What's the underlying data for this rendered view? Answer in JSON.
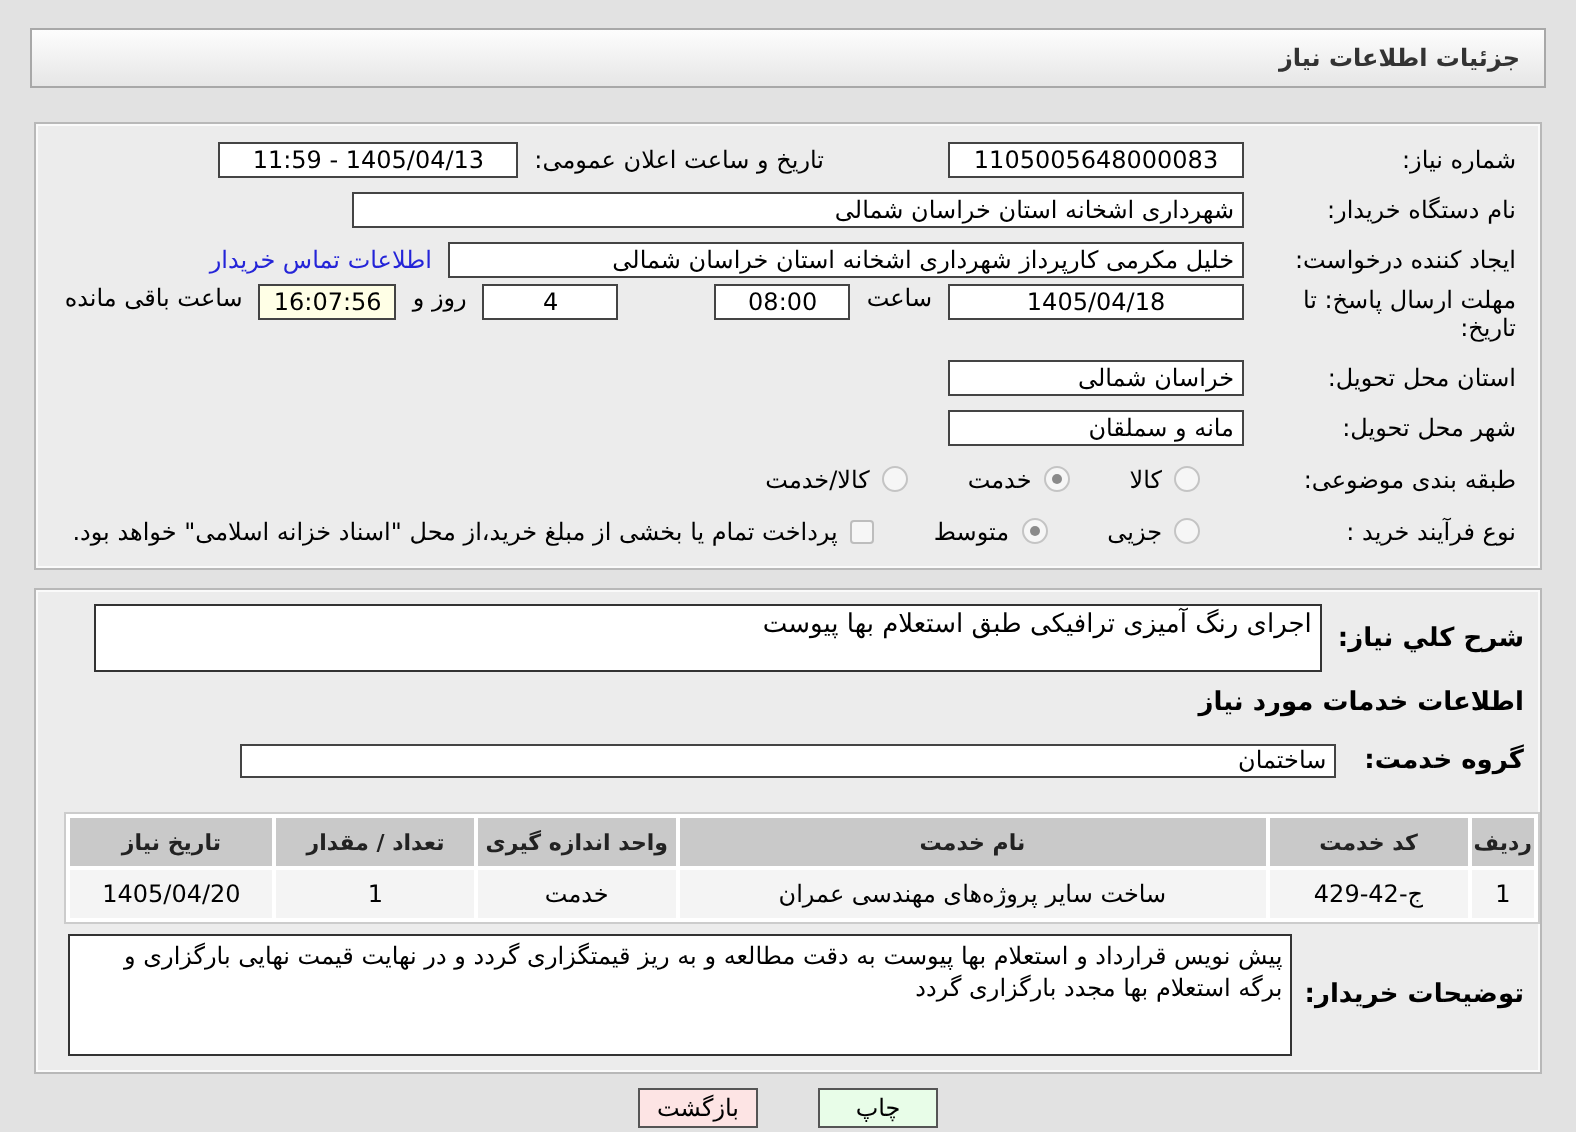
{
  "header": {
    "title": "جزئیات اطلاعات نیاز"
  },
  "need_number": {
    "label": "شماره نیاز:",
    "value": "1105005648000083"
  },
  "announce": {
    "label": "تاریخ و ساعت اعلان عمومی:",
    "value": "1405/04/13 - 11:59"
  },
  "buyer_org": {
    "label": "نام دستگاه خریدار:",
    "value": "شهرداری اشخانه استان خراسان شمالی"
  },
  "requester": {
    "label": "ایجاد کننده درخواست:",
    "value": "خلیل مکرمی کارپرداز شهرداری اشخانه استان خراسان شمالی",
    "link": "اطلاعات تماس خریدار"
  },
  "deadline": {
    "label": "مهلت ارسال پاسخ: تا تاریخ:",
    "date": "1405/04/18",
    "time_label": "ساعت",
    "time": "08:00",
    "days": "4",
    "days_label": "روز و",
    "remaining": "16:07:56",
    "remaining_label": "ساعت باقی مانده"
  },
  "province": {
    "label": "استان محل تحویل:",
    "value": "خراسان شمالی"
  },
  "city": {
    "label": "شهر محل تحویل:",
    "value": "مانه و سملقان"
  },
  "category": {
    "label": "طبقه بندی موضوعی:",
    "options": [
      {
        "label": "کالا",
        "selected": false
      },
      {
        "label": "خدمت",
        "selected": true
      },
      {
        "label": "کالا/خدمت",
        "selected": false
      }
    ]
  },
  "process": {
    "label": "نوع فرآیند خرید :",
    "options": [
      {
        "label": "جزیی",
        "selected": false
      },
      {
        "label": "متوسط",
        "selected": true
      }
    ],
    "payment": {
      "checked": false,
      "text": "پرداخت تمام یا بخشی از مبلغ خرید،از محل \"اسناد خزانه اسلامی\" خواهد بود."
    }
  },
  "summary": {
    "label": "شرح كلي نياز:",
    "value": "اجرای رنگ آمیزی ترافیکی طبق استعلام بها پیوست"
  },
  "services_title": "اطلاعات خدمات مورد نیاز",
  "service_group": {
    "label": "گروه خدمت:",
    "value": "ساختمان"
  },
  "table": {
    "columns": [
      "ردیف",
      "کد خدمت",
      "نام خدمت",
      "واحد اندازه گیری",
      "تعداد / مقدار",
      "تاریخ نیاز"
    ],
    "rows": [
      [
        "1",
        "ج-42-429",
        "ساخت سایر پروژه‌های مهندسی عمران",
        "خدمت",
        "1",
        "1405/04/20"
      ]
    ]
  },
  "buyer_notes": {
    "label": "توضیحات خریدار:",
    "value": "پیش نویس قرارداد و استعلام بها پیوست به دقت مطالعه و به ریز قیمتگزاری گردد و در نهایت قیمت نهایی بارگزاری و برگه استعلام بها مجدد بارگزاری گردد"
  },
  "buttons": [
    {
      "label": "چاپ",
      "kind": "print"
    },
    {
      "label": "بازگشت",
      "kind": "back"
    }
  ]
}
